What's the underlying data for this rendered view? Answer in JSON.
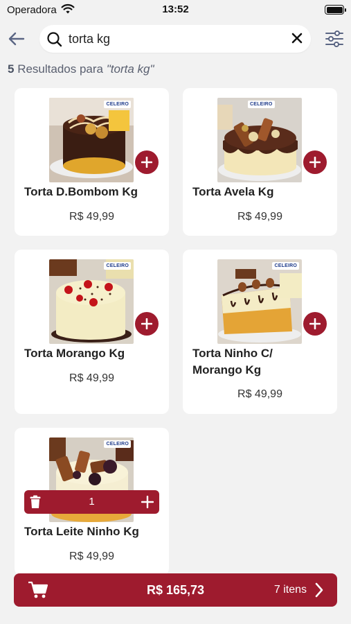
{
  "status_bar": {
    "carrier": "Operadora",
    "time": "13:52"
  },
  "search": {
    "value": "torta kg",
    "placeholder": ""
  },
  "results": {
    "count": "5",
    "prefix": "Resultados para",
    "query": "\"torta kg\""
  },
  "products": [
    {
      "name": "Torta D.Bombom Kg",
      "price": "R$ 49,99",
      "logo": "CELEIRO"
    },
    {
      "name": "Torta Avela Kg",
      "price": "R$ 49,99",
      "logo": "CELEIRO"
    },
    {
      "name": "Torta Morango Kg",
      "price": "R$ 49,99",
      "logo": "CELEIRO"
    },
    {
      "name": "Torta Ninho C/ Morango Kg",
      "price": "R$ 49,99",
      "logo": "CELEIRO"
    },
    {
      "name": "Torta Leite Ninho Kg",
      "price": "R$ 49,99",
      "logo": "CELEIRO",
      "quantity": "1"
    }
  ],
  "cart": {
    "total": "R$ 165,73",
    "items": "7 itens"
  },
  "colors": {
    "accent": "#9e1b2e",
    "background": "#f2f2f2",
    "card": "#ffffff"
  },
  "icons": [
    "wifi-icon",
    "battery-icon",
    "back-arrow-icon",
    "search-icon",
    "close-icon",
    "filter-icon",
    "plus-icon",
    "trash-icon",
    "cart-icon",
    "chevron-right-icon"
  ]
}
